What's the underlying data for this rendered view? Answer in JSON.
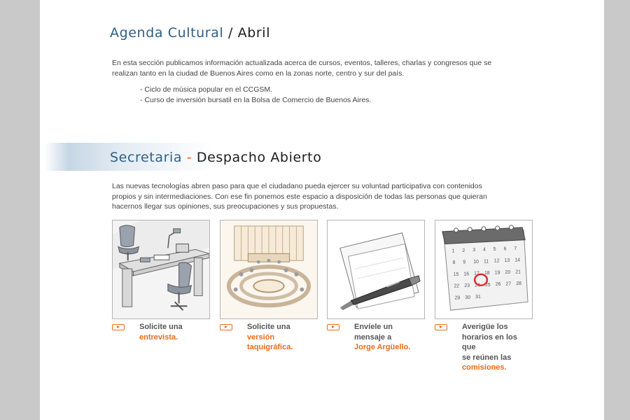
{
  "agenda": {
    "title_accent": "Agenda Cultural",
    "title_sep": " / ",
    "title_month": "Abril",
    "intro_line1": "En esta sección publicamos información actualizada acerca de cursos, eventos, talleres, charlas y congresos que se",
    "intro_line2": "realizan tanto en la ciudad de Buenos Aires como en la zonas norte, centro y sur del país.",
    "events": [
      "- Ciclo de música popular en el CCGSM.",
      "- Curso de inversión bursatil en la Bolsa de Comercio de Buenos Aires."
    ]
  },
  "secretaria": {
    "title_accent": "Secretaria",
    "title_sep": " - ",
    "title_main": "Despacho Abierto",
    "desc_line1": "Las nuevas tecnologías abren paso para que el ciudadano pueda ejercer su voluntad participativa con contenidos",
    "desc_line2": "propios y sin intermediaciones. Con ese fin ponemos este espacio a disposición de todas las personas que quieran",
    "desc_line3": "hacernos llegar sus opiniones, sus preocupaciones y sus propuestas."
  },
  "cards": [
    {
      "illustration": "office-desk",
      "line1": "Solicite una",
      "link": "entrevista."
    },
    {
      "illustration": "assembly-hall",
      "line1": "Solicite una",
      "link1": "versión",
      "link2": "taquigráfica."
    },
    {
      "illustration": "pen-and-paper",
      "line1": "Envíele un",
      "line2": "mensaje a",
      "link": "Jorge Argüello."
    },
    {
      "illustration": "calendar",
      "line1": "Averigüe los",
      "line2": "horarios en los que",
      "line3": "se reúnen las",
      "link": "comisiones."
    }
  ],
  "calendar_numbers": [
    "1",
    "2",
    "3",
    "4",
    "5",
    "6",
    "7",
    "8",
    "9",
    "10",
    "11",
    "12",
    "13",
    "14",
    "15",
    "16",
    "17",
    "18",
    "19",
    "20",
    "21",
    "22",
    "23",
    "24",
    "25",
    "26",
    "27",
    "28",
    "29",
    "30",
    "31"
  ],
  "colors": {
    "accent_blue": "#2f5f86",
    "accent_orange": "#ea6b17",
    "background": "#c9c9c9"
  }
}
